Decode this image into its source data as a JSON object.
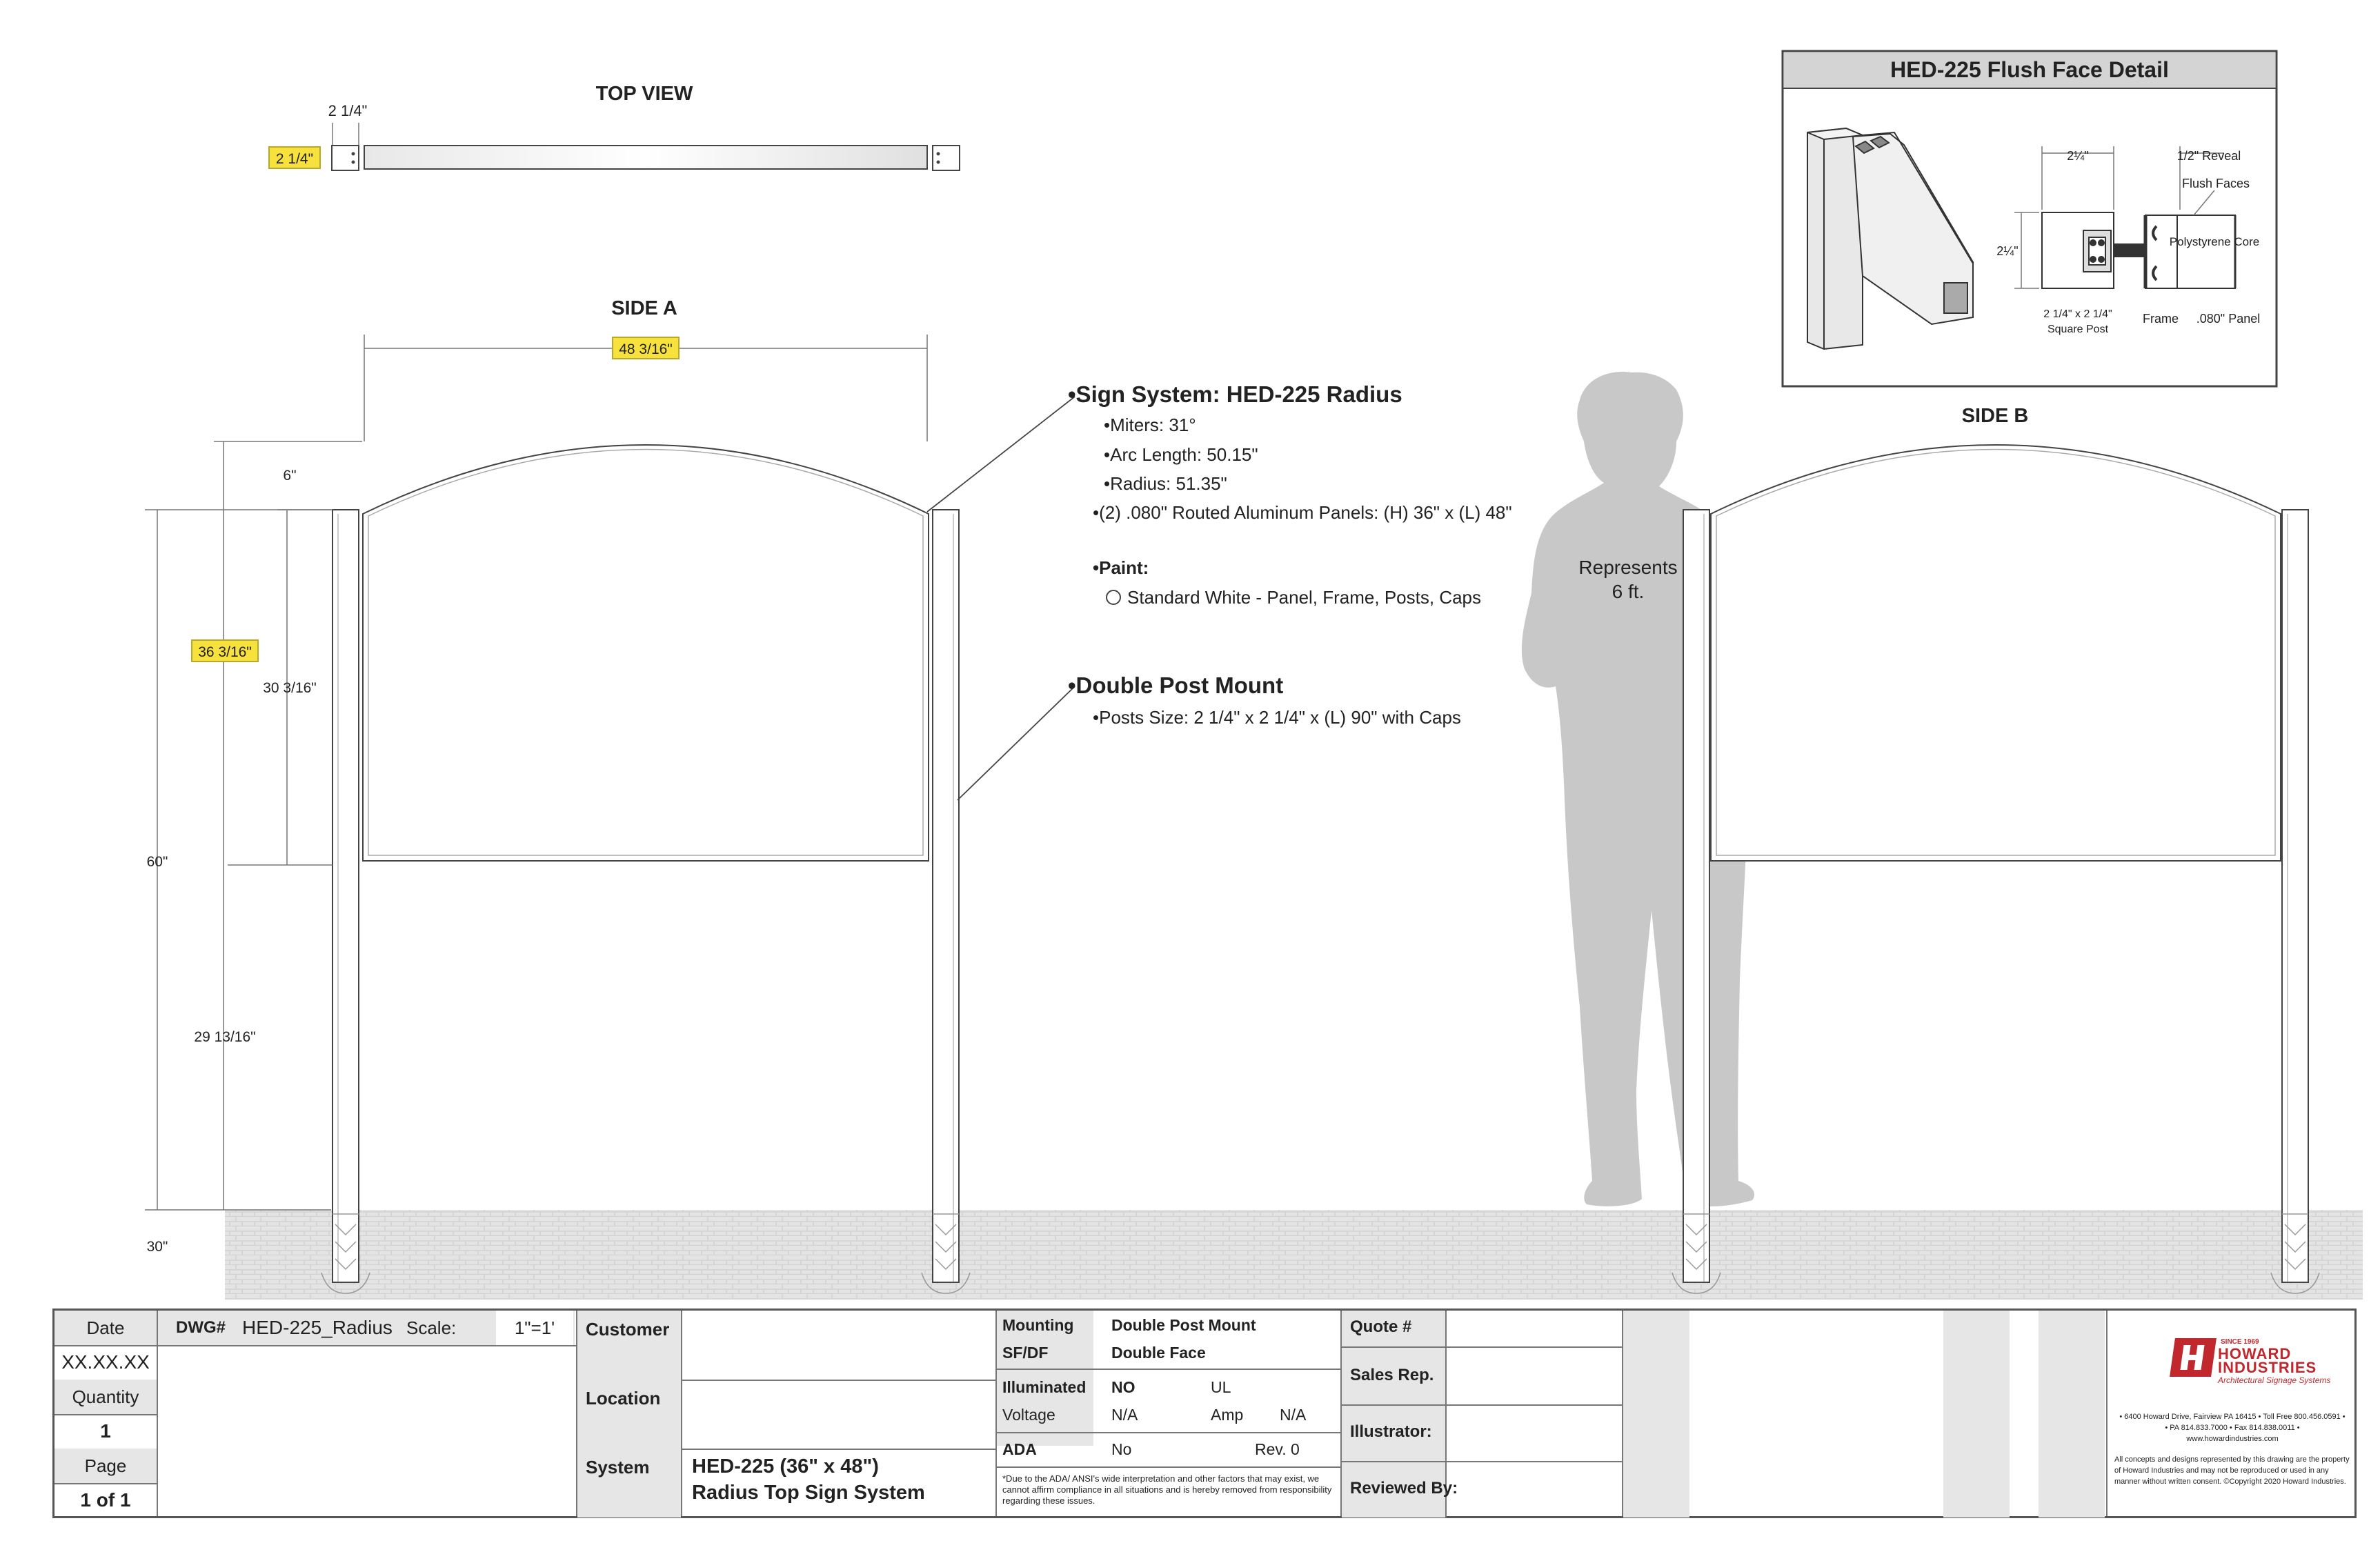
{
  "top_view": {
    "title": "TOP VIEW",
    "dim_width": "2 1/4\"",
    "dim_depth": "2 1/4\""
  },
  "side_a": {
    "title": "SIDE A",
    "dim_width": "48 3/16\"",
    "dim_arc": "6\"",
    "dim_panel": "30 3/16\"",
    "dim_total_sign": "36 3/16\"",
    "dim_ground": "29 13/16\"",
    "dim_overall": "60\"",
    "dim_burial": "30\""
  },
  "side_b": {
    "title": "SIDE B"
  },
  "figure": {
    "label_line1": "Represents",
    "label_line2": "6 ft."
  },
  "notes": {
    "sign_system_title": "•Sign System: HED-225 Radius",
    "miters": "•Miters: 31°",
    "arc_length": "•Arc Length: 50.15\"",
    "radius": "•Radius: 51.35\"",
    "panels": "•(2) .080\" Routed Aluminum Panels: (H) 36\" x (L) 48\"",
    "paint_title": "•Paint:",
    "paint_option": "Standard White - Panel, Frame, Posts, Caps",
    "mount_title": "•Double Post Mount",
    "posts": "•Posts Size: 2 1/4\" x 2 1/4\" x (L) 90\" with Caps"
  },
  "detail": {
    "title": "HED-225 Flush Face Detail",
    "dim_top": "2¼\"",
    "reveal": "1/2\" Reveal",
    "flush_faces": "Flush Faces",
    "dim_side": "2¼\"",
    "core": "Polystyrene Core",
    "post_label_1": "2 1/4\" x 2 1/4\"",
    "post_label_2": "Square Post",
    "frame": "Frame",
    "panel": ".080\" Panel"
  },
  "title_block": {
    "date_label": "Date",
    "date_value": "XX.XX.XX",
    "quantity_label": "Quantity",
    "quantity_value": "1",
    "page_label": "Page",
    "page_value": "1 of 1",
    "dwg_label": "DWG#",
    "dwg_value": "HED-225_Radius",
    "scale_label": "Scale:",
    "scale_value": "1\"=1'",
    "customer_label": "Customer",
    "location_label": "Location",
    "system_label": "System",
    "system_value_1": "HED-225 (36\" x 48\")",
    "system_value_2": "Radius Top Sign System",
    "mounting_label": "Mounting",
    "mounting_value": "Double Post Mount",
    "sfdf_label": "SF/DF",
    "sfdf_value": "Double Face",
    "illuminated_label": "Illuminated",
    "illuminated_value": "NO",
    "ul_label": "UL",
    "voltage_label": "Voltage",
    "voltage_value": "N/A",
    "amp_label": "Amp",
    "amp_value": "N/A",
    "ada_label": "ADA",
    "ada_value": "No",
    "rev_label": "Rev. 0",
    "ada_note": "*Due to the ADA/ ANSI's wide interpretation and other factors that may exist, we cannot affirm compliance in all situations and is hereby removed from responsibility regarding these issues.",
    "quote_label": "Quote #",
    "sales_label": "Sales Rep.",
    "illustrator_label": "Illustrator:",
    "reviewed_label": "Reviewed By:"
  },
  "company": {
    "since": "SINCE 1969",
    "name_1": "HOWARD",
    "name_2": "INDUSTRIES",
    "tagline": "Architectural Signage Systems",
    "address_1": "• 6400 Howard Drive, Fairview PA 16415 • Toll Free 800.456.0591 •",
    "address_2": "• PA 814.833.7000 • Fax 814.838.0011 •",
    "website": "www.howardindustries.com",
    "legal_1": "All concepts and designs represented by this drawing are the property",
    "legal_2": "of Howard Industries and may not be reproduced or used in any",
    "legal_3": "manner without written consent. ©Copyright 2020 Howard Industries."
  },
  "colors": {
    "highlight": "#f7e13c",
    "brand_red": "#c0282e",
    "figure_grey": "#c8c8c8",
    "ground": "#e2e2e2"
  }
}
